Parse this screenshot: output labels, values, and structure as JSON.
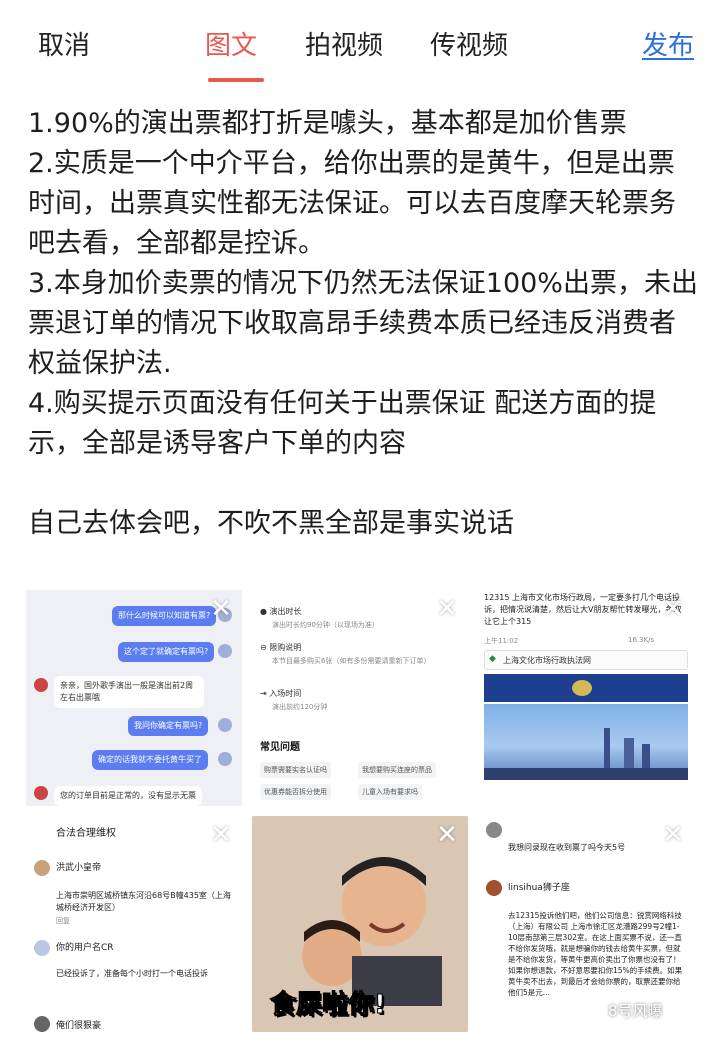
{
  "topbar": {
    "cancel": "取消",
    "tabs": [
      "图文",
      "拍视频",
      "传视频"
    ],
    "active_tab": "图文",
    "publish": "发布",
    "accent_color": "#e8584f",
    "publish_color": "#2f6fd9"
  },
  "post": {
    "p1": "1.90%的演出票都打折是噱头，基本都是加价售票",
    "p2": "2.实质是一个中介平台，给你出票的是黄牛，但是出票时间，出票真实性都无法保证。可以去百度摩天轮票务吧去看，全部都是控诉。",
    "p3": "3.本身加价卖票的情况下仍然无法保证100%出票，未出票退订单的情况下收取高昂手续费本质已经违反消费者权益保护法.",
    "p4": "4.购买提示页面没有任何关于出票保证 配送方面的提示，全部是诱导客户下单的内容",
    "p5": "自己去体会吧，不吹不黑全部是事实说话"
  },
  "thumbs": {
    "t1": {
      "b1": "那什么时候可以知道有票?",
      "b2": "这个定了就确定有票吗?",
      "b3": "亲亲，国外歌手演出一般是演出前2周左右出票哦",
      "b4": "我问你确定有票吗?",
      "b5": "确定的话我就不委托黄牛买了",
      "b6": "您的订单目前是正常的，没有显示无票"
    },
    "t2": {
      "l1": "演出时长",
      "s1": "演出时长约90分钟（以现场为准）",
      "l2": "限购说明",
      "s2": "本节目最多购买6张（如有多份需要请重新下订单）",
      "l3": "入场时间",
      "s3": "演出前约120分钟",
      "faq": "常见问题",
      "c1": "购票需要实名认证吗",
      "c2": "我想要购买连座的票品",
      "c3": "优惠券能否拆分使用",
      "c4": "儿童入场有要求吗"
    },
    "t3": {
      "text": "12315 上海市文化市场行政局，一定要多打几个电话投诉，把情况说清楚，然后让大V朋友帮忙转发曝光，争取让它上个315",
      "status_time": "上午11:02",
      "status_net": "16.3K/s",
      "site": "上海文化市场行政执法网"
    },
    "t4": {
      "header": "合法合理维权",
      "user1": "洪武小皇帝",
      "msg1": "上海市崇明区城桥镇东河沿68号B幢435室（上海城桥经济开发区）",
      "reply": "回复",
      "user2": "你的用户名CR",
      "msg2": "已经投诉了，准备每个小时打一个电话投诉",
      "user3": "俺们很狠豪"
    },
    "t5": {
      "caption": "食屎啦你!"
    },
    "t6": {
      "q": "我想问录现在收到票了吗今天5号",
      "user": "linsihua狮子座",
      "msg": "去12315投诉他们吧，他们公司信息：锐赏网络科技（上海）有限公司 上海市徐汇区龙漕路299号2幢1-10层南部第三层302室。在这上面买票不说，还一直不给你发货哦，就是想骗你的钱去给黄牛买票，但就是不给你发货，等黄牛更高价卖出了你票也没有了！如果你想退款，不好意思要扣你15%的手续费。如果黄牛卖不出去，到最后才会给你票的，取票还要你给他们5是元..."
    }
  },
  "watermark": "8号风曝"
}
